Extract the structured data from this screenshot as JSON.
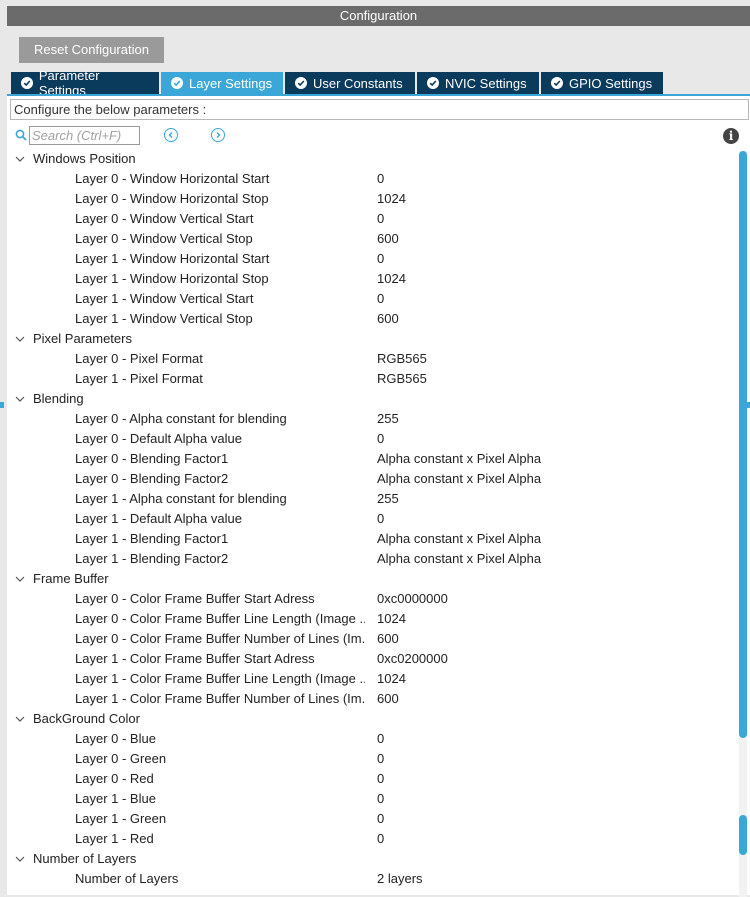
{
  "window": {
    "title": "Configuration"
  },
  "toolbar": {
    "reset_label": "Reset Configuration"
  },
  "tabs": [
    {
      "label": "Parameter Settings",
      "active": false
    },
    {
      "label": "Layer Settings",
      "active": true
    },
    {
      "label": "User Constants",
      "active": false
    },
    {
      "label": "NVIC Settings",
      "active": false
    },
    {
      "label": "GPIO Settings",
      "active": false
    }
  ],
  "configure_text": "Configure the below parameters :",
  "search": {
    "placeholder": "Search (Ctrl+F)"
  },
  "groups": [
    {
      "name": "Windows Position",
      "params": [
        {
          "name": "Layer 0 - Window Horizontal Start",
          "value": "0"
        },
        {
          "name": "Layer 0 - Window Horizontal Stop",
          "value": "1024"
        },
        {
          "name": "Layer 0 - Window Vertical Start",
          "value": "0"
        },
        {
          "name": "Layer 0 - Window Vertical Stop",
          "value": "600"
        },
        {
          "name": "Layer 1 - Window Horizontal Start",
          "value": "0"
        },
        {
          "name": "Layer 1 - Window Horizontal Stop",
          "value": "1024"
        },
        {
          "name": "Layer 1 - Window Vertical Start",
          "value": "0"
        },
        {
          "name": "Layer 1 - Window Vertical Stop",
          "value": "600"
        }
      ]
    },
    {
      "name": "Pixel Parameters",
      "params": [
        {
          "name": "Layer 0 - Pixel Format",
          "value": "RGB565"
        },
        {
          "name": "Layer 1 - Pixel Format",
          "value": "RGB565"
        }
      ]
    },
    {
      "name": "Blending",
      "params": [
        {
          "name": "Layer 0 - Alpha constant for blending",
          "value": "255"
        },
        {
          "name": "Layer 0 - Default Alpha value",
          "value": "0"
        },
        {
          "name": "Layer 0 - Blending Factor1",
          "value": "Alpha constant x Pixel Alpha"
        },
        {
          "name": "Layer 0 - Blending Factor2",
          "value": "Alpha constant x Pixel Alpha"
        },
        {
          "name": "Layer 1 - Alpha constant for blending",
          "value": "255"
        },
        {
          "name": "Layer 1 - Default Alpha value",
          "value": "0"
        },
        {
          "name": "Layer 1 - Blending Factor1",
          "value": "Alpha constant x Pixel Alpha"
        },
        {
          "name": "Layer 1 - Blending Factor2",
          "value": "Alpha constant x Pixel Alpha"
        }
      ]
    },
    {
      "name": "Frame Buffer",
      "params": [
        {
          "name": "Layer 0 - Color Frame Buffer Start Adress",
          "value": "0xc0000000"
        },
        {
          "name": "Layer 0 - Color Frame Buffer Line Length (Image ...",
          "value": "1024"
        },
        {
          "name": "Layer 0 - Color Frame Buffer Number of Lines (Im...",
          "value": "600"
        },
        {
          "name": "Layer 1 - Color Frame Buffer Start Adress",
          "value": "0xc0200000"
        },
        {
          "name": "Layer 1 - Color Frame Buffer Line Length (Image ...",
          "value": "1024"
        },
        {
          "name": "Layer 1 - Color Frame Buffer Number of Lines (Im...",
          "value": "600"
        }
      ]
    },
    {
      "name": "BackGround Color",
      "params": [
        {
          "name": "Layer 0 - Blue",
          "value": "0"
        },
        {
          "name": "Layer 0 - Green",
          "value": "0"
        },
        {
          "name": "Layer 0 - Red",
          "value": "0"
        },
        {
          "name": "Layer 1 - Blue",
          "value": "0"
        },
        {
          "name": "Layer 1 - Green",
          "value": "0"
        },
        {
          "name": "Layer 1 - Red",
          "value": "0"
        }
      ]
    },
    {
      "name": "Number of Layers",
      "params": [
        {
          "name": "Number of Layers",
          "value": "2 layers"
        }
      ]
    }
  ],
  "colors": {
    "accent": "#3aa7d8",
    "tab_bg": "#0a3a5c",
    "title_bg": "#6b6b6b",
    "reset_bg": "#9a9a9a"
  },
  "icons": {
    "tab_check": "check-circle-icon",
    "search": "search-icon",
    "prev": "chevron-left-icon",
    "next": "chevron-right-icon",
    "info": "info-icon",
    "expand": "chevron-down-icon"
  }
}
